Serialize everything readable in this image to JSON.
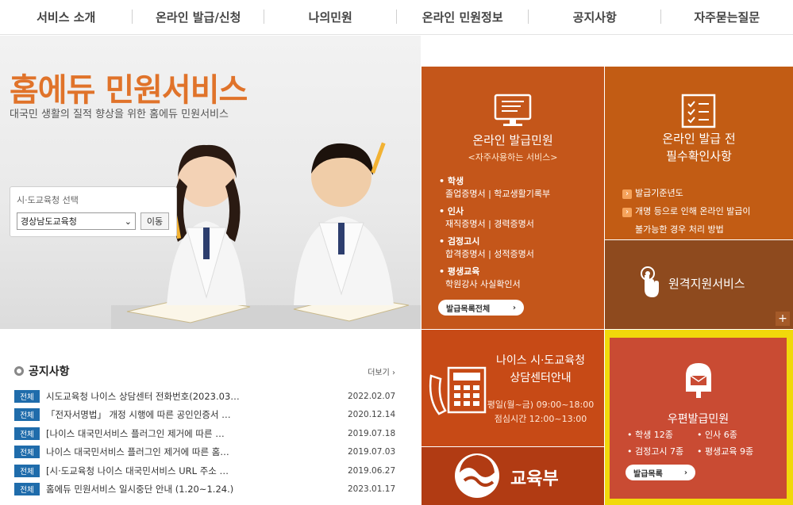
{
  "nav": {
    "items": [
      {
        "label": "서비스 소개"
      },
      {
        "label": "온라인 발급/신청"
      },
      {
        "label": "나의민원"
      },
      {
        "label": "온라인 민원정보"
      },
      {
        "label": "공지사항"
      },
      {
        "label": "자주묻는질문"
      }
    ]
  },
  "hero": {
    "title": "홈에듀 민원서비스",
    "subtitle": "대국민 생활의 질적 향상을 위한 홈에듀 민원서비스",
    "region": {
      "label": "시·도교육청 선택",
      "selected": "경상남도교육청",
      "button": "이동"
    }
  },
  "tiles": {
    "online": {
      "title": "온라인 발급민원",
      "subtitle": "<자주사용하는 서비스>",
      "categories": [
        {
          "name": "학생",
          "items": "졸업증명서  |  학교생활기록부"
        },
        {
          "name": "인사",
          "items": "재직증명서  |  경력증명서"
        },
        {
          "name": "검정고시",
          "items": "합격증명서  |  성적증명서"
        },
        {
          "name": "평생교육",
          "items": "학원강사 사실확인서"
        }
      ],
      "button": "발급목록전체"
    },
    "precheck": {
      "title_line1": "온라인 발급 전",
      "title_line2": "필수확인사항",
      "notes": [
        "발급기준년도",
        "개명 등으로 인해 온라인 발급이",
        "불가능한 경우 처리 방법"
      ]
    },
    "remote": {
      "title": "원격지원서비스",
      "plus": "+"
    },
    "consult": {
      "title_line1": "나이스 시·도교육청",
      "title_line2": "상담센터안내",
      "hours_line1": "평일(월~금) 09:00~18:00",
      "hours_line2": "점심시간 12:00~13:00"
    },
    "moe": {
      "title": "교육부"
    },
    "postal": {
      "title": "우편발급민원",
      "counts": [
        "학생 12종",
        "인사 6종",
        "검정고시 7종",
        "평생교육 9종"
      ],
      "button": "발급목록"
    }
  },
  "notice": {
    "title": "공지사항",
    "more": "더보기",
    "rows": [
      {
        "badge": "전체",
        "text": "시도교육청 나이스 상담센터 전화번호(2023.03…",
        "date": "2022.02.07"
      },
      {
        "badge": "전체",
        "text": "「전자서명법」 개정 시행에 따른 공인인증서 …",
        "date": "2020.12.14"
      },
      {
        "badge": "전체",
        "text": "[나이스 대국민서비스 플러그인 제거에 따른 …",
        "date": "2019.07.18"
      },
      {
        "badge": "전체",
        "text": "나이스 대국민서비스 플러그인 제거에 따른 홈…",
        "date": "2019.07.03"
      },
      {
        "badge": "전체",
        "text": "[시·도교육청 나이스 대국민서비스 URL 주소 …",
        "date": "2019.06.27"
      },
      {
        "badge": "전체",
        "text": "홈에듀 민원서비스 일시중단 안내 (1.20~1.24.)",
        "date": "2023.01.17"
      }
    ]
  }
}
